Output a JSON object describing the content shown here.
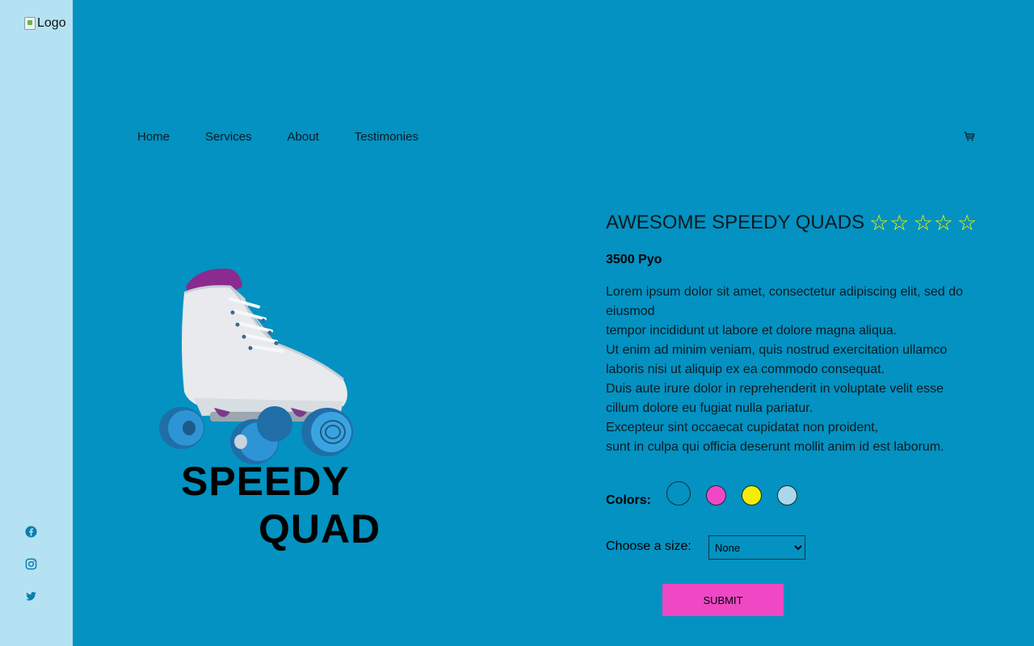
{
  "sidebar": {
    "logo_alt": "Logo",
    "social": [
      {
        "icon": "facebook-icon"
      },
      {
        "icon": "instagram-icon"
      },
      {
        "icon": "twitter-icon"
      }
    ],
    "icon_color": "#0a7fb0"
  },
  "nav": {
    "items": [
      "Home",
      "Services",
      "About",
      "Testimonies"
    ],
    "cart_icon": "cart-icon"
  },
  "hero": {
    "line1": "SPEEDY",
    "line2": "QUAD",
    "image": "roller-skate-image"
  },
  "product": {
    "title": "AWESOME SPEEDY QUADS",
    "stars": [
      "☆",
      "☆",
      "☆",
      "☆",
      "☆"
    ],
    "price": "3500 Pyo",
    "description": [
      "Lorem ipsum dolor sit amet, consectetur adipiscing elit, sed do eiusmod",
      "tempor incididunt ut labore et dolore magna aliqua.",
      "Ut enim ad minim veniam, quis nostrud exercitation ullamco laboris nisi ut aliquip ex ea commodo consequat.",
      "Duis aute irure dolor in reprehenderit in voluptate velit esse cillum dolore eu fugiat nulla pariatur.",
      "Excepteur sint occaecat cupidatat non proident,",
      "sunt in culpa qui officia deserunt mollit anim id est laborum."
    ],
    "colors_label": "Colors:",
    "colors": [
      "#0392c2",
      "#ee48c5",
      "#f4ef00",
      "#a8d8ea"
    ],
    "size_label": "Choose a size:",
    "size_selected": "None",
    "submit_label": "SUBMIT"
  },
  "theme": {
    "background": "#0392c2",
    "sidebar_bg": "#b5e2f2",
    "accent": "#ee48c5",
    "star_color": "#f2f200"
  }
}
